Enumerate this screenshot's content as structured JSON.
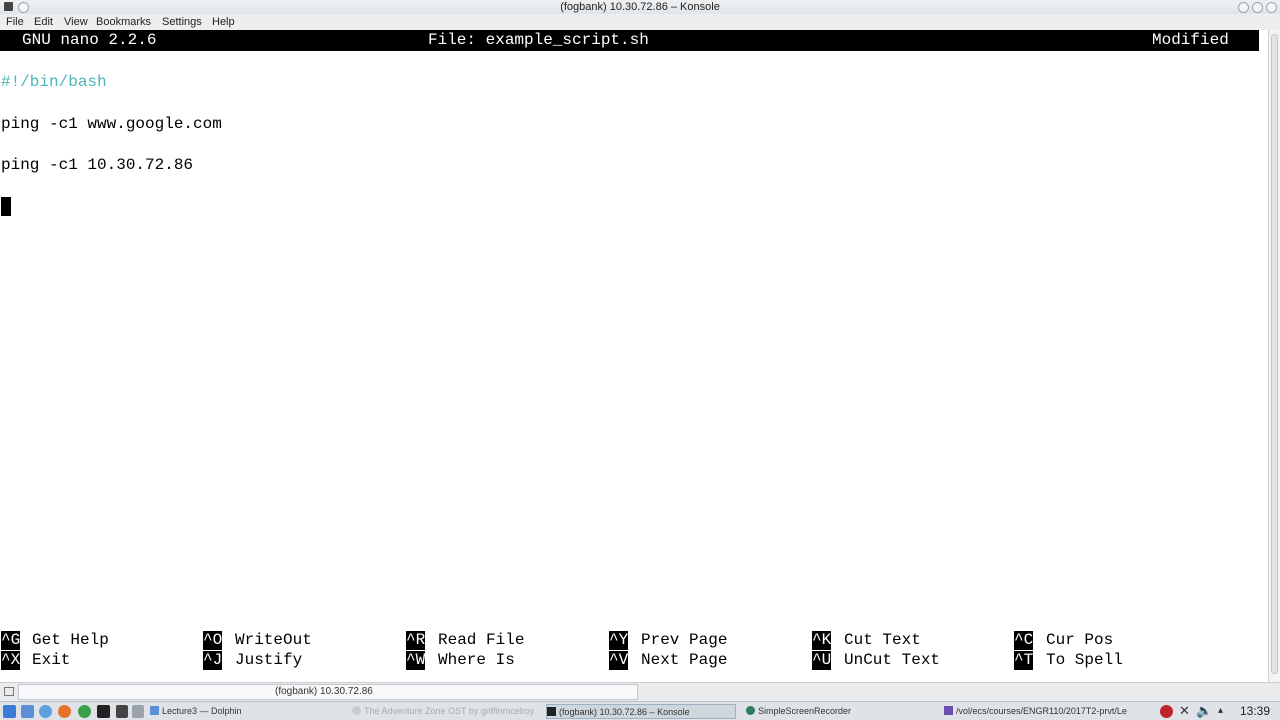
{
  "window": {
    "title": "(fogbank) 10.30.72.86 – Konsole"
  },
  "menubar": {
    "items": [
      "File",
      "Edit",
      "View",
      "Bookmarks",
      "Settings",
      "Help"
    ]
  },
  "nano": {
    "version": "GNU nano 2.2.6",
    "file": "File: example_script.sh",
    "status": "Modified",
    "lines": [
      "#!/bin/bash",
      "ping -c1 www.google.com",
      "ping -c1 10.30.72.86"
    ],
    "shortcuts": [
      {
        "key": "^G",
        "label": "Get Help"
      },
      {
        "key": "^O",
        "label": "WriteOut"
      },
      {
        "key": "^R",
        "label": "Read File"
      },
      {
        "key": "^Y",
        "label": "Prev Page"
      },
      {
        "key": "^K",
        "label": "Cut Text"
      },
      {
        "key": "^C",
        "label": "Cur Pos"
      },
      {
        "key": "^X",
        "label": "Exit"
      },
      {
        "key": "^J",
        "label": "Justify"
      },
      {
        "key": "^W",
        "label": "Where Is"
      },
      {
        "key": "^V",
        "label": "Next Page"
      },
      {
        "key": "^U",
        "label": "UnCut Text"
      },
      {
        "key": "^T",
        "label": "To Spell"
      }
    ]
  },
  "tabbar": {
    "tab_label": "(fogbank) 10.30.72.86"
  },
  "taskbar": {
    "tasks": [
      "Lecture3 — Dolphin",
      "The Adventure Zone OST by griffinmcelroy",
      "(fogbank) 10.30.72.86 – Konsole",
      "SimpleScreenRecorder",
      "/vol/ecs/courses/ENGR110/2017T2-prvt/Le"
    ],
    "clock": "13:39"
  },
  "colors": {
    "shebang": "#4cb5b9",
    "header_bg": "#000000",
    "accent": "#3a7bd5"
  }
}
